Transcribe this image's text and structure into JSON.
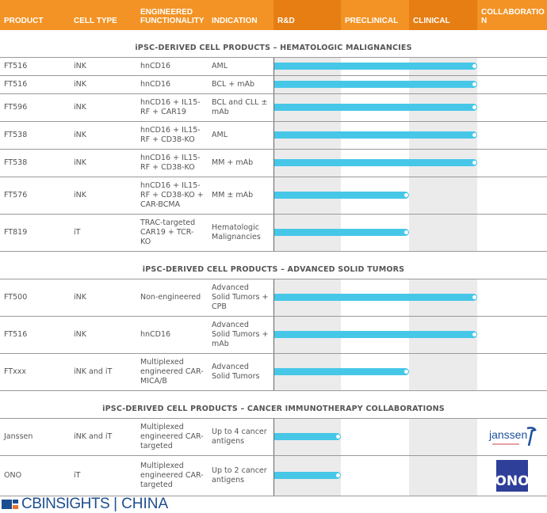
{
  "header": {
    "columns": [
      "PRODUCT",
      "CELL TYPE",
      "ENGINEERED FUNCTIONALITY",
      "INDICATION",
      "R&D",
      "PRECLINICAL",
      "CLINICAL",
      "COLLABORATIO N"
    ]
  },
  "colors": {
    "header": "#f39325",
    "header_dark": "#e67e14",
    "bar": "#47c7e8",
    "shade": "#ebebeb"
  },
  "stages": [
    "R&D",
    "Preclinical",
    "Clinical"
  ],
  "sections": [
    {
      "title": "iPSC-DERIVED CELL PRODUCTS – HEMATOLOGIC MALIGNANCIES",
      "rows": [
        {
          "product": "FT516",
          "cell_type": "iNK",
          "functionality": "hnCD16",
          "indication": "AML",
          "stage_reached": "Clinical"
        },
        {
          "product": "FT516",
          "cell_type": "iNK",
          "functionality": "hnCD16",
          "indication": "BCL + mAb",
          "stage_reached": "Clinical"
        },
        {
          "product": "FT596",
          "cell_type": "iNK",
          "functionality": "hnCD16 + IL15-RF + CAR19",
          "indication": "BCL and CLL ± mAb",
          "stage_reached": "Clinical"
        },
        {
          "product": "FT538",
          "cell_type": "iNK",
          "functionality": "hnCD16 + IL15-RF + CD38-KO",
          "indication": "AML",
          "stage_reached": "Clinical"
        },
        {
          "product": "FT538",
          "cell_type": "iNK",
          "functionality": "hnCD16 + IL15-RF + CD38-KO",
          "indication": "MM + mAb",
          "stage_reached": "Clinical"
        },
        {
          "product": "FT576",
          "cell_type": "iNK",
          "functionality": "hnCD16 + IL15-RF + CD38-KO + CAR-BCMA",
          "indication": "MM ± mAb",
          "stage_reached": "Preclinical"
        },
        {
          "product": "FT819",
          "cell_type": "iT",
          "functionality": "TRAC-targeted CAR19 + TCR-KO",
          "indication": "Hematologic Malignancies",
          "stage_reached": "Preclinical"
        }
      ]
    },
    {
      "title": "iPSC-DERIVED CELL PRODUCTS – ADVANCED SOLID TUMORS",
      "rows": [
        {
          "product": "FT500",
          "cell_type": "iNK",
          "functionality": "Non-engineered",
          "indication": "Advanced Solid Tumors + CPB",
          "stage_reached": "Clinical"
        },
        {
          "product": "FT516",
          "cell_type": "iNK",
          "functionality": "hnCD16",
          "indication": "Advanced Solid Tumors + mAb",
          "stage_reached": "Clinical"
        },
        {
          "product": "FTxxx",
          "cell_type": "iNK and iT",
          "functionality": "Multiplexed engineered CAR-MICA/B",
          "indication": "Advanced Solid Tumors",
          "stage_reached": "Preclinical"
        }
      ]
    },
    {
      "title": "iPSC-DERIVED CELL PRODUCTS – CANCER IMMUNOTHERAPY COLLABORATIONS",
      "rows": [
        {
          "product": "Janssen",
          "cell_type": "iNK and iT",
          "functionality": "Multiplexed engineered CAR-targeted",
          "indication": "Up to 4 cancer antigens",
          "stage_reached": "R&D",
          "collaborator": "janssen"
        },
        {
          "product": "ONO",
          "cell_type": "iT",
          "functionality": "Multiplexed engineered CAR-targeted",
          "indication": "Up to 2 cancer antigens",
          "stage_reached": "R&D",
          "collaborator": "ONO"
        }
      ]
    }
  ],
  "footer": {
    "brand": "CBINSIGHTS",
    "region": "CHINA"
  }
}
